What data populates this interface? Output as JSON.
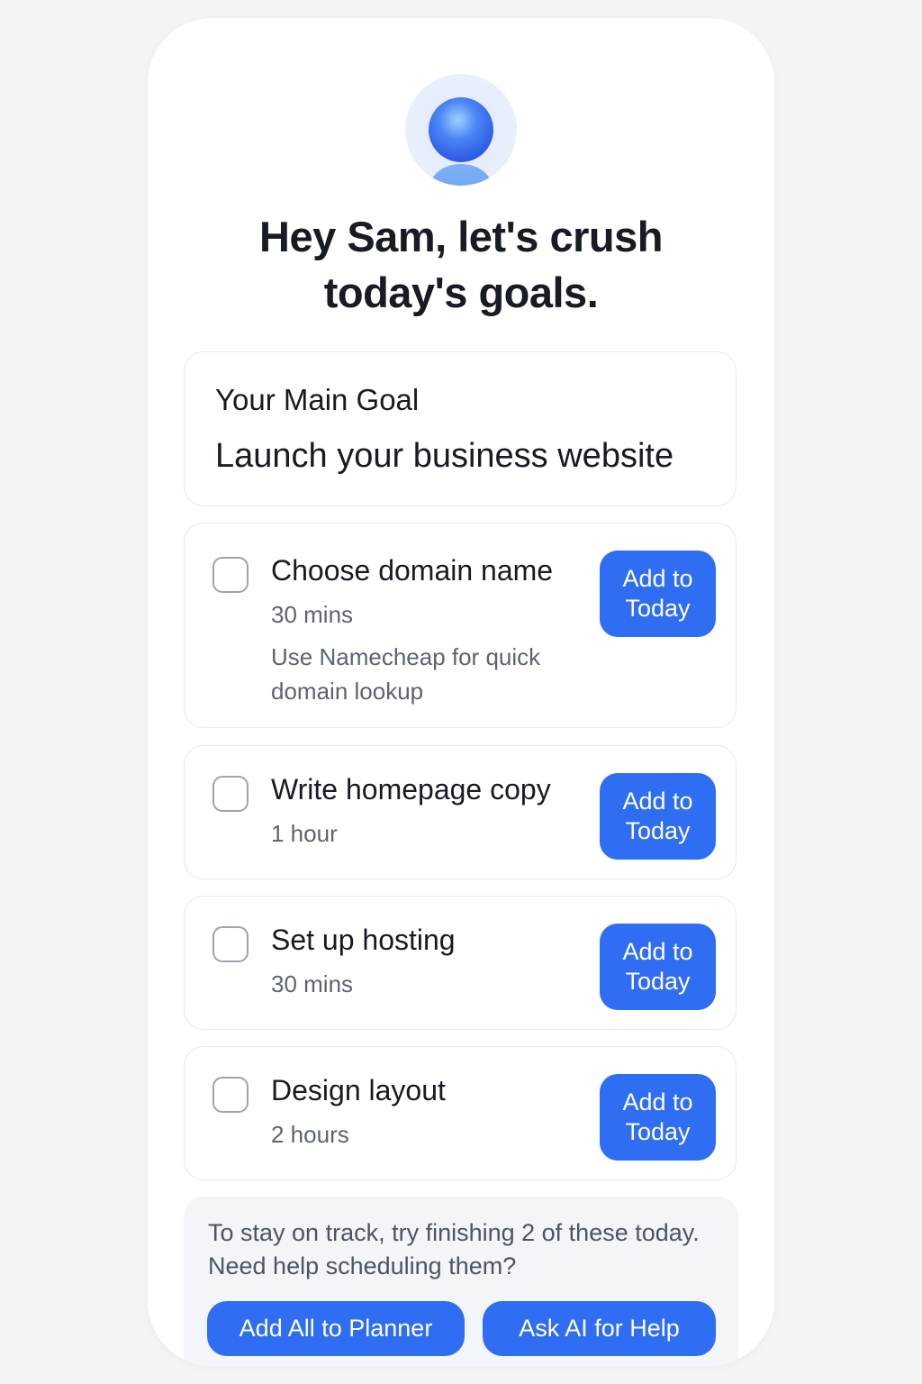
{
  "greeting": {
    "line1": "Hey Sam, let's crush",
    "line2": "today's goals."
  },
  "main_goal": {
    "label": "Your Main Goal",
    "title": "Launch your business website"
  },
  "tasks": [
    {
      "title": "Choose domain name",
      "duration": "30 mins",
      "tip": "Use Namecheap for quick domain lookup",
      "checked": false,
      "button_label": "Add to Today"
    },
    {
      "title": "Write homepage copy",
      "duration": "1 hour",
      "checked": false,
      "button_label": "Add to Today"
    },
    {
      "title": "Set up hosting",
      "duration": "30 mins",
      "checked": false,
      "button_label": "Add to Today"
    },
    {
      "title": "Design layout",
      "duration": "2 hours",
      "checked": false,
      "button_label": "Add to Today"
    }
  ],
  "footer": {
    "message": "To stay on track, try finishing 2 of these today. Need help scheduling them?",
    "add_all_label": "Add All to Planner",
    "ask_ai_label": "Ask AI for Help"
  },
  "colors": {
    "accent": "#2f6df2",
    "text_primary": "#161b24",
    "text_secondary": "#5b6472"
  },
  "icons": {
    "avatar": "user-avatar-icon"
  }
}
